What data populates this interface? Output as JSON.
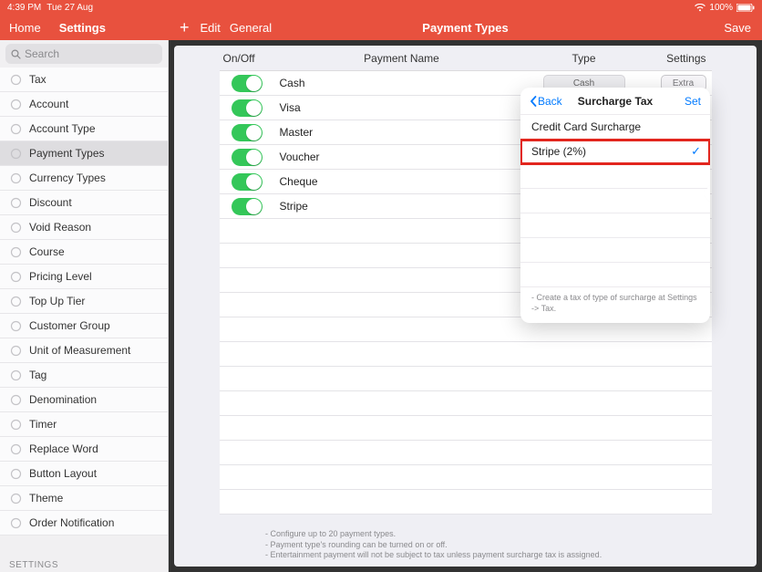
{
  "status": {
    "time": "4:39 PM",
    "date": "Tue 27 Aug",
    "battery": "100%"
  },
  "header": {
    "left": {
      "home": "Home",
      "settings": "Settings"
    },
    "right": {
      "edit": "Edit",
      "general": "General",
      "title": "Payment Types",
      "save": "Save"
    }
  },
  "search": {
    "placeholder": "Search"
  },
  "sidebar": {
    "items": [
      {
        "label": "Tax"
      },
      {
        "label": "Account"
      },
      {
        "label": "Account Type"
      },
      {
        "label": "Payment Types"
      },
      {
        "label": "Currency Types"
      },
      {
        "label": "Discount"
      },
      {
        "label": "Void Reason"
      },
      {
        "label": "Course"
      },
      {
        "label": "Pricing Level"
      },
      {
        "label": "Top Up Tier"
      },
      {
        "label": "Customer Group"
      },
      {
        "label": "Unit of Measurement"
      },
      {
        "label": "Tag"
      },
      {
        "label": "Denomination"
      },
      {
        "label": "Timer"
      },
      {
        "label": "Replace Word"
      },
      {
        "label": "Button Layout"
      },
      {
        "label": "Theme"
      },
      {
        "label": "Order Notification"
      }
    ],
    "section": "SETTINGS"
  },
  "table": {
    "headers": {
      "onoff": "On/Off",
      "name": "Payment Name",
      "type": "Type",
      "settings": "Settings"
    },
    "rows": [
      {
        "name": "Cash",
        "type": "Cash"
      },
      {
        "name": "Visa",
        "type": ""
      },
      {
        "name": "Master",
        "type": ""
      },
      {
        "name": "Voucher",
        "type": ""
      },
      {
        "name": "Cheque",
        "type": ""
      },
      {
        "name": "Stripe",
        "type": ""
      }
    ],
    "extra_label": "Extra"
  },
  "popover": {
    "back": "Back",
    "title": "Surcharge Tax",
    "set": "Set",
    "rows": [
      {
        "label": "Credit Card Surcharge",
        "checked": false,
        "highlight": false
      },
      {
        "label": "Stripe (2%)",
        "checked": true,
        "highlight": true
      }
    ],
    "foot": "- Create a tax of type of surcharge at Settings -> Tax."
  },
  "footer": {
    "l1": "- Configure up to 20 payment types.",
    "l2": "- Payment type's rounding can be turned on or off.",
    "l3": "- Entertainment payment will not be subject to tax unless payment surcharge tax is assigned."
  }
}
